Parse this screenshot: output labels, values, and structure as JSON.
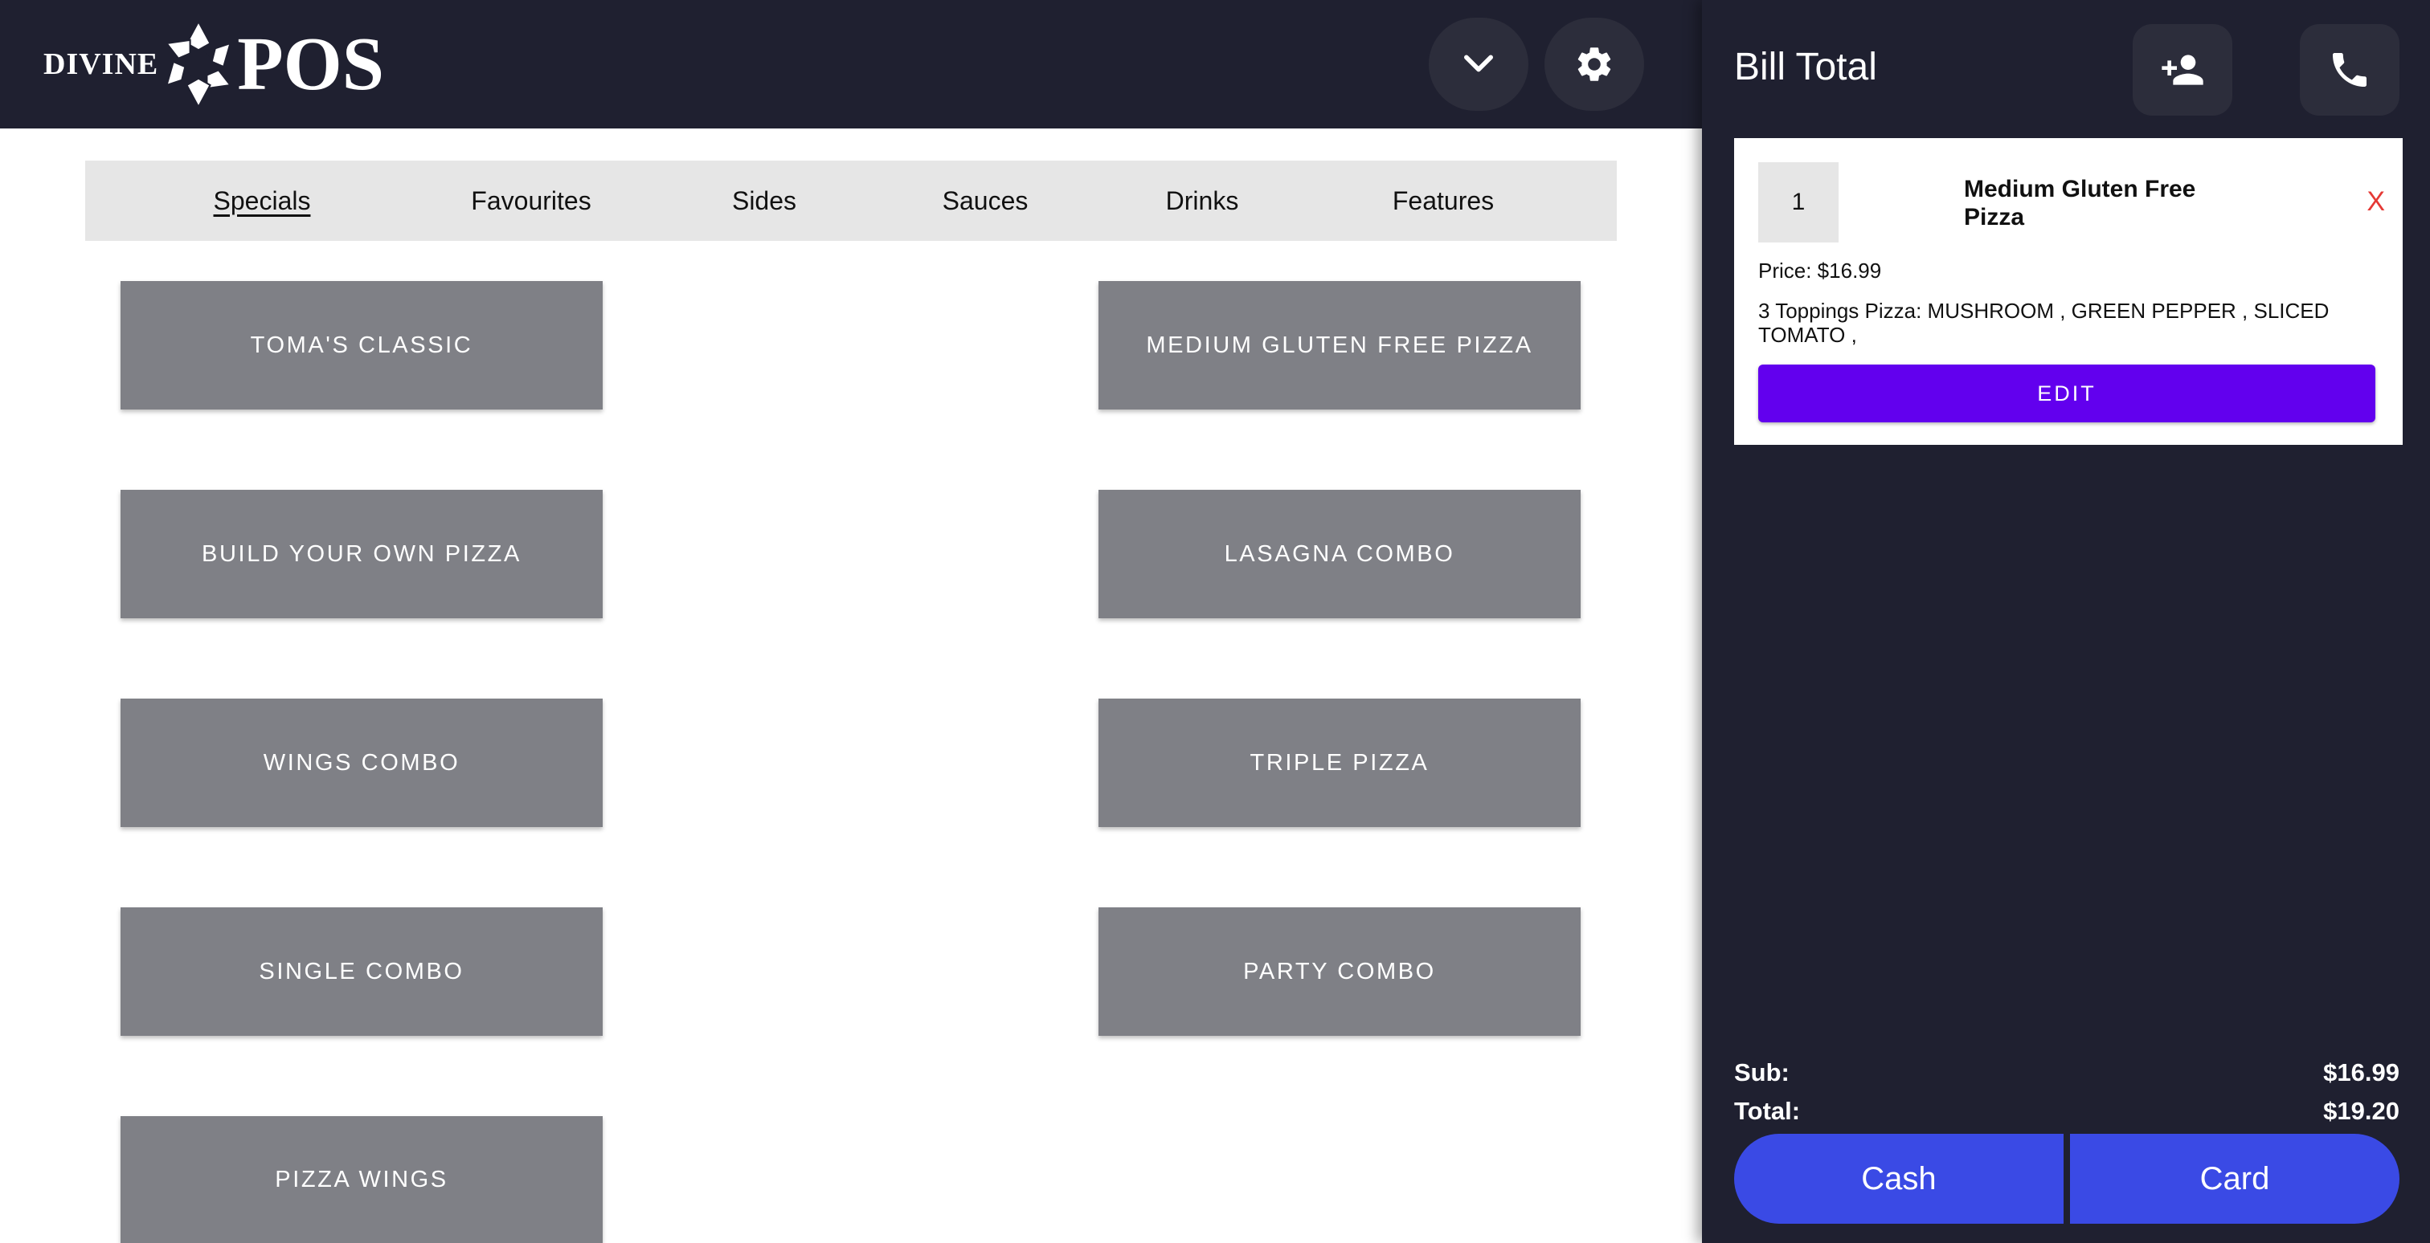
{
  "header": {
    "logo_left": "DIVINE",
    "logo_right": "POS",
    "buttons": [
      {
        "icon": "chevron-down-icon"
      },
      {
        "icon": "gear-icon"
      }
    ]
  },
  "tabs": [
    {
      "label": "Specials",
      "active": true
    },
    {
      "label": "Favourites",
      "active": false
    },
    {
      "label": "Sides",
      "active": false
    },
    {
      "label": "Sauces",
      "active": false
    },
    {
      "label": "Drinks",
      "active": false
    },
    {
      "label": "Features",
      "active": false
    }
  ],
  "menu_items": [
    "TOMA'S CLASSIC",
    "MEDIUM GLUTEN FREE PIZZA",
    "BUILD YOUR OWN PIZZA",
    "LASAGNA COMBO",
    "WINGS COMBO",
    "TRIPLE PIZZA",
    "SINGLE COMBO",
    "PARTY COMBO",
    "PIZZA WINGS"
  ],
  "bill": {
    "title": "Bill Total",
    "add_customer_icon": "person-add-icon",
    "phone_icon": "phone-icon",
    "items": [
      {
        "qty": "1",
        "name": "Medium Gluten Free Pizza",
        "remove": "X",
        "price": "Price: $16.99",
        "toppings": "3 Toppings Pizza: MUSHROOM , GREEN PEPPER , SLICED TOMATO ,",
        "edit": "EDIT"
      }
    ],
    "sub_label": "Sub:",
    "sub_value": "$16.99",
    "total_label": "Total:",
    "total_value": "$19.20",
    "cash": "Cash",
    "card": "Card"
  },
  "colors": {
    "dark": "#1f2030",
    "tile": "#7f8086",
    "edit": "#6200ee",
    "pay": "#3a4ae5",
    "remove": "#e53935"
  }
}
